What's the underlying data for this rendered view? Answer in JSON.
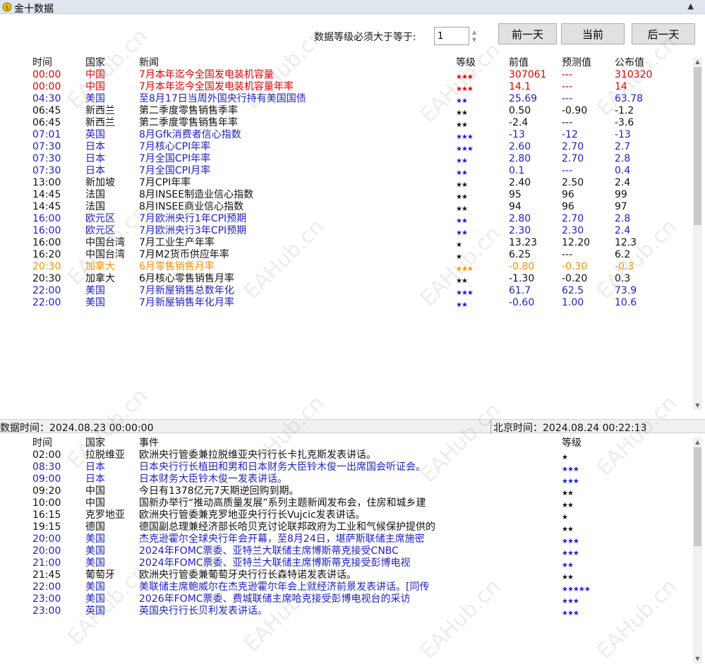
{
  "window": {
    "title": "金十数据",
    "close_glyph": "▲"
  },
  "toolbar": {
    "level_label": "数据等级必须大于等于:",
    "level_value": "1",
    "prev_day": "前一天",
    "today": "当前",
    "next_day": "后一天"
  },
  "data_table": {
    "headers": {
      "time": "时间",
      "country": "国家",
      "news": "新闻",
      "level": "等级",
      "previous": "前值",
      "forecast": "预测值",
      "actual": "公布值"
    },
    "rows": [
      {
        "time": "00:00",
        "country": "中国",
        "news": "7月本年迄今全国发电装机容量",
        "stars": "★★★",
        "previous": "307061",
        "forecast": "---",
        "actual": "310320",
        "color": "red"
      },
      {
        "time": "00:00",
        "country": "中国",
        "news": "7月本年迄今全国发电装机容量年率",
        "stars": "★★★",
        "previous": "14.1",
        "forecast": "---",
        "actual": "14",
        "color": "red"
      },
      {
        "time": "04:30",
        "country": "美国",
        "news": "至8月17日当周外国央行持有美国国债",
        "stars": "★★",
        "previous": "25.69",
        "forecast": "---",
        "actual": "63.78",
        "color": "blue"
      },
      {
        "time": "06:45",
        "country": "新西兰",
        "news": "第二季度零售销售季率",
        "stars": "★★",
        "previous": "0.50",
        "forecast": "-0.90",
        "actual": "-1.2",
        "color": "black"
      },
      {
        "time": "06:45",
        "country": "新西兰",
        "news": "第二季度零售销售年率",
        "stars": "★★",
        "previous": "-2.4",
        "forecast": "---",
        "actual": "-3.6",
        "color": "black"
      },
      {
        "time": "07:01",
        "country": "英国",
        "news": "8月Gfk消费者信心指数",
        "stars": "★★★",
        "previous": "-13",
        "forecast": "-12",
        "actual": "-13",
        "color": "blue"
      },
      {
        "time": "07:30",
        "country": "日本",
        "news": "7月核心CPI年率",
        "stars": "★★★",
        "previous": "2.60",
        "forecast": "2.70",
        "actual": "2.7",
        "color": "blue"
      },
      {
        "time": "07:30",
        "country": "日本",
        "news": "7月全国CPI年率",
        "stars": "★★",
        "previous": "2.80",
        "forecast": "2.70",
        "actual": "2.8",
        "color": "blue"
      },
      {
        "time": "07:30",
        "country": "日本",
        "news": "7月全国CPI月率",
        "stars": "★★",
        "previous": "0.1",
        "forecast": "---",
        "actual": "0.4",
        "color": "blue"
      },
      {
        "time": "13:00",
        "country": "新加坡",
        "news": "7月CPI年率",
        "stars": "★★",
        "previous": "2.40",
        "forecast": "2.50",
        "actual": "2.4",
        "color": "black"
      },
      {
        "time": "14:45",
        "country": "法国",
        "news": "8月INSEE制造业信心指数",
        "stars": "★★",
        "previous": "95",
        "forecast": "96",
        "actual": "99",
        "color": "black"
      },
      {
        "time": "14:45",
        "country": "法国",
        "news": "8月INSEE商业信心指数",
        "stars": "★★",
        "previous": "94",
        "forecast": "96",
        "actual": "97",
        "color": "black"
      },
      {
        "time": "16:00",
        "country": "欧元区",
        "news": "7月欧洲央行1年CPI预期",
        "stars": "★★",
        "previous": "2.80",
        "forecast": "2.70",
        "actual": "2.8",
        "color": "blue"
      },
      {
        "time": "16:00",
        "country": "欧元区",
        "news": "7月欧洲央行3年CPI预期",
        "stars": "★★",
        "previous": "2.30",
        "forecast": "2.30",
        "actual": "2.4",
        "color": "blue"
      },
      {
        "time": "16:00",
        "country": "中国台湾",
        "news": "7月工业生产年率",
        "stars": "★",
        "previous": "13.23",
        "forecast": "12.20",
        "actual": "12.3",
        "color": "black"
      },
      {
        "time": "16:20",
        "country": "中国台湾",
        "news": "7月M2货币供应年率",
        "stars": "★",
        "previous": "6.25",
        "forecast": "---",
        "actual": "6.2",
        "color": "black"
      },
      {
        "time": "20:30",
        "country": "加拿大",
        "news": "6月零售销售月率",
        "stars": "★★★",
        "previous": "-0.80",
        "forecast": "-0.30",
        "actual": "-0.3",
        "color": "orange"
      },
      {
        "time": "20:30",
        "country": "加拿大",
        "news": "6月核心零售销售月率",
        "stars": "★★",
        "previous": "-1.30",
        "forecast": "-0.20",
        "actual": "0.3",
        "color": "black"
      },
      {
        "time": "22:00",
        "country": "美国",
        "news": "7月新屋销售总数年化",
        "stars": "★★★",
        "previous": "61.7",
        "forecast": "62.5",
        "actual": "73.9",
        "color": "blue"
      },
      {
        "time": "22:00",
        "country": "美国",
        "news": "7月新屋销售年化月率",
        "stars": "★★",
        "previous": "-0.60",
        "forecast": "1.00",
        "actual": "10.6",
        "color": "blue"
      }
    ]
  },
  "status_bar": {
    "data_time": "数据时间：2024.08.23 00:00:00",
    "beijing_time": "北京时间：2024.08.24 00:22:13"
  },
  "events_table": {
    "headers": {
      "time": "时间",
      "country": "国家",
      "event": "事件",
      "level": "等级"
    },
    "rows": [
      {
        "time": "02:00",
        "country": "拉脱维亚",
        "event": "欧洲央行管委兼拉脱维亚央行行长卡扎克斯发表讲话。",
        "stars": "★",
        "color": "black"
      },
      {
        "time": "08:30",
        "country": "日本",
        "event": "日本央行行长植田和男和日本财务大臣铃木俊一出席国会听证会。",
        "stars": "★★★",
        "color": "blue"
      },
      {
        "time": "09:00",
        "country": "日本",
        "event": "日本财务大臣铃木俊一发表讲话。",
        "stars": "★★★",
        "color": "blue"
      },
      {
        "time": "09:20",
        "country": "中国",
        "event": "今日有1378亿元7天期逆回购到期。",
        "stars": "★★",
        "color": "black"
      },
      {
        "time": "10:00",
        "country": "中国",
        "event": "国新办举行“推动高质量发展”系列主题新闻发布会，住房和城乡建",
        "stars": "★★",
        "color": "black"
      },
      {
        "time": "16:15",
        "country": "克罗地亚",
        "event": "欧洲央行管委兼克罗地亚央行行长Vujcic发表讲话。",
        "stars": "★",
        "color": "black"
      },
      {
        "time": "19:15",
        "country": "德国",
        "event": "德国副总理兼经济部长哈贝克讨论联邦政府为工业和气候保护提供的",
        "stars": "★★",
        "color": "black"
      },
      {
        "time": "20:00",
        "country": "美国",
        "event": "杰克逊霍尔全球央行年会开幕，至8月24日，堪萨斯联储主席施密",
        "stars": "★★★",
        "color": "blue"
      },
      {
        "time": "20:00",
        "country": "美国",
        "event": "2024年FOMC票委、亚特兰大联储主席博斯蒂克接受CNBC",
        "stars": "★★★",
        "color": "blue"
      },
      {
        "time": "21:00",
        "country": "美国",
        "event": "2024年FOMC票委、亚特兰大联储主席博斯蒂克接受彭博电视",
        "stars": "★★",
        "color": "blue"
      },
      {
        "time": "21:45",
        "country": "葡萄牙",
        "event": "欧洲央行管委兼葡萄牙央行行长森特诺发表讲话。",
        "stars": "★★",
        "color": "black"
      },
      {
        "time": "22:00",
        "country": "美国",
        "event": "美联储主席鲍威尔在杰克逊霍尔年会上就经济前景发表讲话。[同传",
        "stars": "★★★★★",
        "color": "blue"
      },
      {
        "time": "23:00",
        "country": "美国",
        "event": "2026年FOMC票委、费城联储主席哈克接受彭博电视台的采访",
        "stars": "★★★",
        "color": "blue"
      },
      {
        "time": "23:00",
        "country": "英国",
        "event": "英国央行行长贝利发表讲话。",
        "stars": "★★★",
        "color": "blue"
      }
    ]
  },
  "watermark": "EAHub.cn",
  "colors": {
    "red": "#e00000",
    "blue": "#1f1fbf",
    "orange": "#f39200",
    "black": "#111111"
  }
}
